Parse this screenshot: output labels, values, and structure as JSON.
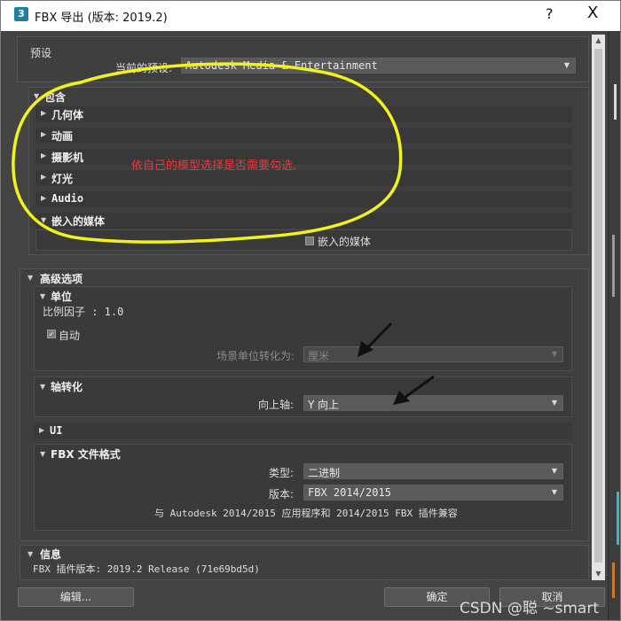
{
  "window": {
    "app_icon": "3",
    "title": "FBX 导出 (版本: 2019.2)",
    "help_glyph": "?",
    "close_glyph": "X"
  },
  "presets": {
    "section_label": "预设",
    "current_label": "当前的预设:",
    "current_value": "Autodesk Media & Entertainment"
  },
  "include": {
    "title": "包含",
    "items": [
      "几何体",
      "动画",
      "摄影机",
      "灯光",
      "Audio",
      "嵌入的媒体"
    ],
    "embed_checkbox_label": "嵌入的媒体"
  },
  "annotation": {
    "note": "依自己的模型选择是否需要勾选,",
    "colors": {
      "ellipse": "#f3f31a",
      "arrows": "#111111",
      "note": "#e8393c"
    }
  },
  "advanced": {
    "title": "高级选项",
    "units": {
      "title": "单位",
      "scale_factor": "比例因子 : 1.0",
      "auto_label": "自动",
      "auto_checked": true,
      "convert_label": "场景单位转化为:",
      "convert_value": "厘米"
    },
    "axis": {
      "title": "轴转化",
      "up_axis_label": "向上轴:",
      "up_axis_value": "Y 向上"
    },
    "ui_title": "UI",
    "fbx_format": {
      "title": "FBX 文件格式",
      "type_label": "类型:",
      "type_value": "二进制",
      "version_label": "版本:",
      "version_value": "FBX 2014/2015",
      "compat_text": "与 Autodesk 2014/2015 应用程序和 2014/2015 FBX 插件兼容"
    }
  },
  "info": {
    "title": "信息",
    "plugin_version": "FBX 插件版本: 2019.2 Release (71e69bd5d)"
  },
  "buttons": {
    "edit": "编辑...",
    "ok": "确定",
    "cancel": "取消"
  },
  "watermark": "CSDN @聪 ~smart"
}
